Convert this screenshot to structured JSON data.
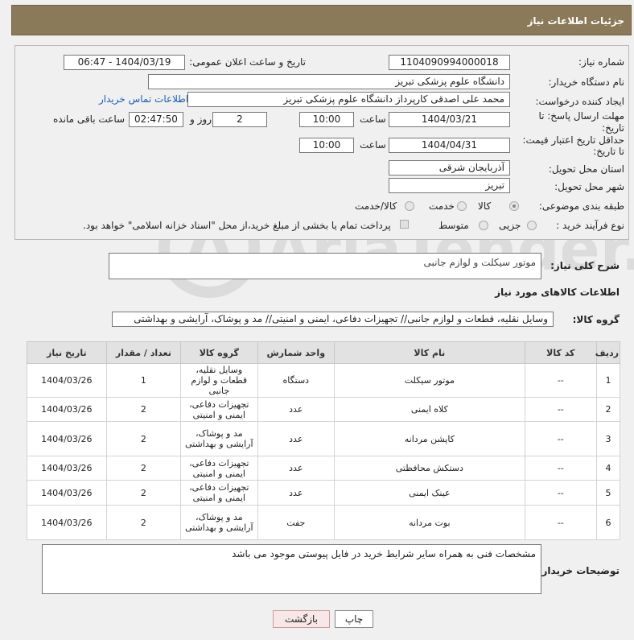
{
  "header": {
    "title": "جزئیات اطلاعات نیاز"
  },
  "form": {
    "need_number_label": "شماره نیاز:",
    "need_number": "1104090994000018",
    "announce_label": "تاریخ و ساعت اعلان عمومی:",
    "announce_value": "1404/03/19 - 06:47",
    "buyer_org_label": "نام دستگاه خریدار:",
    "buyer_org": "دانشگاه علوم پزشکی تبریز",
    "requester_label": "ایجاد کننده درخواست:",
    "requester": "محمد علی  اصدقی کارپرداز دانشگاه علوم پزشکی تبریز",
    "contact_link": "اطلاعات تماس خریدار",
    "deadline_label_1": "مهلت ارسال پاسخ: تا",
    "deadline_label_2": "تاریخ:",
    "deadline_date": "1404/03/21",
    "time_label": "ساعت",
    "deadline_time": "10:00",
    "days_value": "2",
    "days_label": "روز و",
    "remaining_time": "02:47:50",
    "remaining_label": "ساعت باقی مانده",
    "price_label_1": "حداقل تاریخ اعتبار قیمت:",
    "price_label_2": "تا تاریخ:",
    "price_date": "1404/04/31",
    "price_time_label": "ساعت",
    "price_time": "10:00",
    "province_label": "استان محل تحویل:",
    "province": "آذربایجان شرقی",
    "city_label": "شهر محل تحویل:",
    "city": "تبریز",
    "category_label": "طبقه بندی موضوعی:",
    "category_options": [
      "کالا",
      "خدمت",
      "کالا/خدمت"
    ],
    "process_label": "نوع فرآیند خرید :",
    "process_options": [
      "جزیی",
      "متوسط"
    ],
    "payment_note": "پرداخت تمام یا بخشی از مبلغ خرید،از محل \"اسناد خزانه اسلامی\" خواهد بود."
  },
  "description": {
    "label": "شرح کلی نیاز:",
    "value": "موتور سیکلت و لوازم جانبی"
  },
  "goods_section_title": "اطلاعات کالاهای مورد نیاز",
  "goods_group": {
    "label": "گروه کالا:",
    "value": "وسایل نقلیه، قطعات و لوازم جانبی// تجهیزات دفاعی، ایمنی و امنیتی// مد و پوشاک، آرایشی و بهداشتی"
  },
  "table": {
    "headers": [
      "ردیف",
      "کد کالا",
      "نام کالا",
      "واحد شمارش",
      "گروه کالا",
      "تعداد / مقدار",
      "تاریخ نیاز"
    ],
    "rows": [
      {
        "row": "1",
        "code": "--",
        "name": "موتور سیکلت",
        "unit": "دستگاه",
        "group": "وسایل نقلیه، قطعات و لوازم جانبی",
        "qty": "1",
        "date": "1404/03/26"
      },
      {
        "row": "2",
        "code": "--",
        "name": "کلاه ایمنی",
        "unit": "عدد",
        "group": "تجهیزات دفاعی، ایمنی و امنیتی",
        "qty": "2",
        "date": "1404/03/26"
      },
      {
        "row": "3",
        "code": "--",
        "name": "کاپشن مردانه",
        "unit": "عدد",
        "group": "مد و پوشاک، آرایشی و بهداشتی",
        "qty": "2",
        "date": "1404/03/26"
      },
      {
        "row": "4",
        "code": "--",
        "name": "دستکش محافظتی",
        "unit": "عدد",
        "group": "تجهیزات دفاعی، ایمنی و امنیتی",
        "qty": "2",
        "date": "1404/03/26"
      },
      {
        "row": "5",
        "code": "--",
        "name": "عینک ایمنی",
        "unit": "عدد",
        "group": "تجهیزات دفاعی، ایمنی و امنیتی",
        "qty": "2",
        "date": "1404/03/26"
      },
      {
        "row": "6",
        "code": "--",
        "name": "بوت مردانه",
        "unit": "جفت",
        "group": "مد و پوشاک، آرایشی و بهداشتی",
        "qty": "2",
        "date": "1404/03/26"
      }
    ]
  },
  "buyer_notes": {
    "label": "توضیحات خریدار:",
    "value": "مشخصات فنی به همراه سایر شرایط خرید در فایل پیوستی موجود می باشد"
  },
  "buttons": {
    "print": "چاپ",
    "back": "بازگشت"
  },
  "watermark": "AriaTender.neT"
}
